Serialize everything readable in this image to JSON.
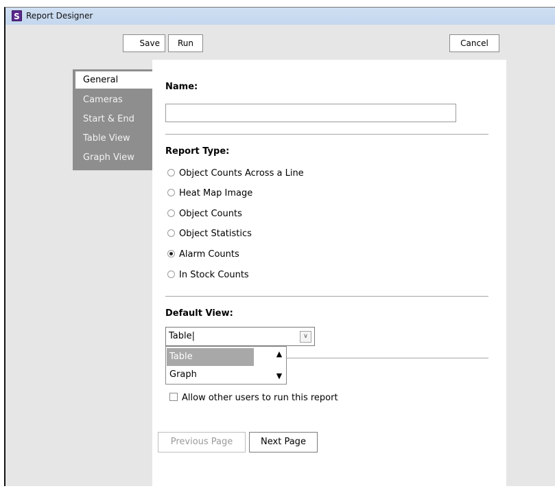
{
  "window": {
    "title": "Report Designer",
    "icon": "report-designer-app-icon",
    "icon_letter": "S"
  },
  "toolbar": {
    "save_label": "Save",
    "run_label": "Run",
    "cancel_label": "Cancel"
  },
  "sidebar": {
    "items": [
      {
        "label": "General",
        "active": true
      },
      {
        "label": "Cameras",
        "active": false
      },
      {
        "label": "Start & End",
        "active": false
      },
      {
        "label": "Table View",
        "active": false
      },
      {
        "label": "Graph View",
        "active": false
      }
    ]
  },
  "general": {
    "name_label": "Name:",
    "name_value": "",
    "report_type_label": "Report Type:",
    "report_types": [
      {
        "label": "Object Counts Across a Line",
        "checked": false
      },
      {
        "label": "Heat Map Image",
        "checked": false
      },
      {
        "label": "Object Counts",
        "checked": false
      },
      {
        "label": "Object Statistics",
        "checked": false
      },
      {
        "label": "Alarm Counts",
        "checked": true
      },
      {
        "label": "In Stock Counts",
        "checked": false
      }
    ],
    "default_view_label": "Default View:",
    "default_view_value": "Table|",
    "default_view_options": [
      "Table",
      "Graph"
    ],
    "allow_others_label": "Allow other users to run this report",
    "allow_others_checked": false
  },
  "footer": {
    "previous_label": "Previous Page",
    "next_label": "Next Page"
  }
}
